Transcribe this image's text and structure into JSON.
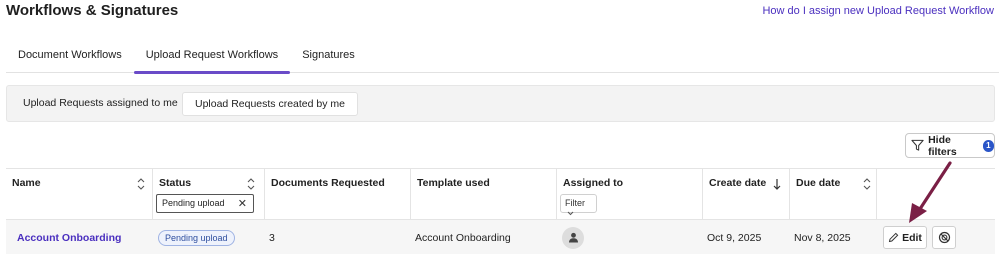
{
  "header": {
    "title": "Workflows & Signatures",
    "help_link": "How do I assign new Upload Request Workflow"
  },
  "tabs": [
    {
      "label": "Document Workflows",
      "active": false
    },
    {
      "label": "Upload Request Workflows",
      "active": true
    },
    {
      "label": "Signatures",
      "active": false
    }
  ],
  "subtabs": [
    {
      "label": "Upload Requests assigned to me",
      "selected": false
    },
    {
      "label": "Upload Requests created by me",
      "selected": true
    }
  ],
  "toolbar": {
    "hide_filters_label": "Hide filters",
    "filter_count": "1"
  },
  "table": {
    "columns": {
      "name": "Name",
      "status": "Status",
      "documents_requested": "Documents Requested",
      "template_used": "Template used",
      "assigned_to": "Assigned to",
      "create_date": "Create date",
      "due_date": "Due date"
    },
    "filters": {
      "status_value": "Pending upload",
      "assigned_to_label": "Filter"
    },
    "rows": [
      {
        "name": "Account Onboarding",
        "status": "Pending upload",
        "documents_requested": "3",
        "template_used": "Account Onboarding",
        "create_date": "Oct 9, 2025",
        "due_date": "Nov 8, 2025",
        "edit_label": "Edit"
      }
    ]
  },
  "colors": {
    "accent": "#6a4bc8",
    "link": "#4a2fbf",
    "badge": "#2a55c8",
    "annotation_arrow": "#7a1f45"
  }
}
